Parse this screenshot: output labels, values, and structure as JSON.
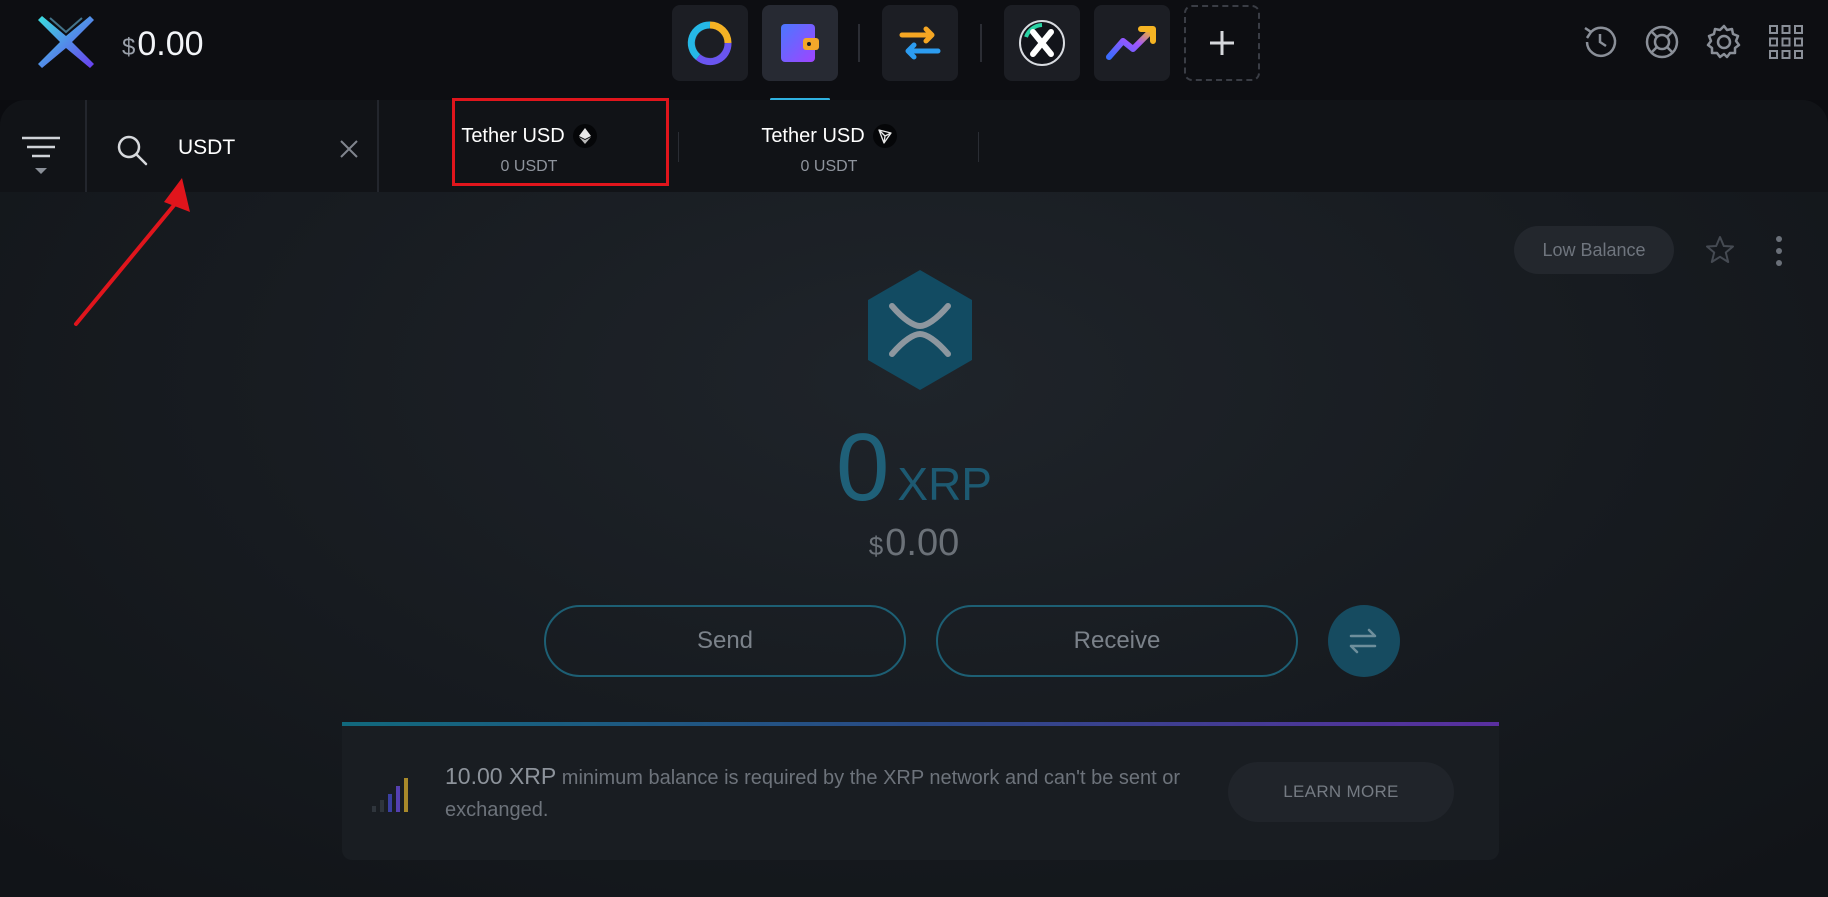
{
  "header": {
    "balance_currency": "$",
    "balance_value": "0.00",
    "apps": [
      {
        "name": "portfolio",
        "icon": "portfolio-donut-icon"
      },
      {
        "name": "wallet",
        "icon": "wallet-icon",
        "active": true
      },
      {
        "name": "exchange",
        "icon": "exchange-arrows-icon"
      },
      {
        "name": "exodus",
        "icon": "exodus-x-icon"
      },
      {
        "name": "trends",
        "icon": "trend-chart-icon"
      },
      {
        "name": "add-app",
        "icon": "plus-icon"
      }
    ],
    "right_icons": [
      "history-icon",
      "help-lifebuoy-icon",
      "settings-gear-icon",
      "apps-grid-icon"
    ]
  },
  "assetbar": {
    "search_value": "USDT",
    "tabs": [
      {
        "name": "Tether USD",
        "chain_icon": "ethereum-icon",
        "balance": "0 USDT"
      },
      {
        "name": "Tether USD",
        "chain_icon": "tron-icon",
        "balance": "0 USDT"
      }
    ]
  },
  "asset": {
    "low_balance_label": "Low Balance",
    "amount": "0",
    "ticker": "XRP",
    "fiat_currency": "$",
    "fiat_value": "0.00",
    "send_label": "Send",
    "receive_label": "Receive"
  },
  "notice": {
    "strong": "10.00 XRP",
    "text": " minimum balance is required by the XRP network and can't be sent or exchanged.",
    "button": "LEARN MORE"
  },
  "colors": {
    "accent_teal": "#1d5f74",
    "highlight_red": "#e0151c",
    "active_indicator": "#2fb1e0"
  }
}
